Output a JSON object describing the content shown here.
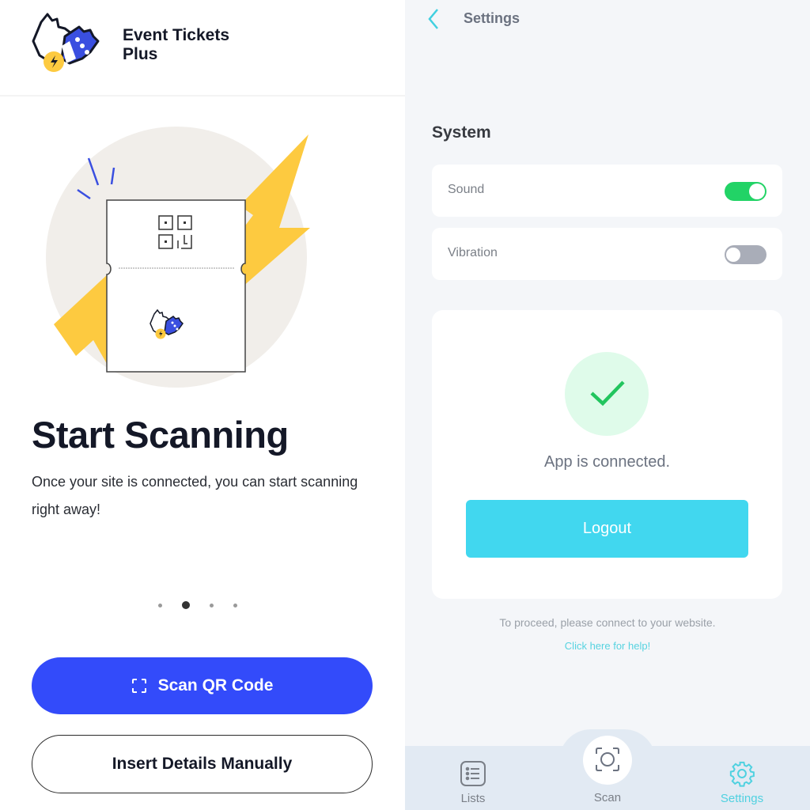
{
  "left": {
    "brand": {
      "line1": "Event Tickets",
      "line2": "Plus"
    },
    "onboarding": {
      "title": "Start Scanning",
      "description": "Once your site is connected, you can start scanning right away!",
      "pagination": {
        "total": 4,
        "active_index": 1
      }
    },
    "buttons": {
      "scan_qr": "Scan QR Code",
      "insert_manually": "Insert Details Manually"
    },
    "colors": {
      "primary": "#334bfa",
      "accent_yellow": "#fdca40",
      "ink": "#141827"
    }
  },
  "right": {
    "header": {
      "title": "Settings",
      "back_icon": "chevron-left-icon"
    },
    "system": {
      "heading": "System",
      "settings": [
        {
          "label": "Sound",
          "enabled": true
        },
        {
          "label": "Vibration",
          "enabled": false
        }
      ]
    },
    "connection": {
      "status": "App is connected.",
      "status_icon": "check-icon",
      "logout_label": "Logout"
    },
    "hint": "To proceed, please connect to your website.",
    "help_link": "Click here for help!",
    "tabbar": {
      "tabs": [
        {
          "label": "Lists",
          "icon": "list-icon",
          "active": false
        },
        {
          "label": "Scan",
          "icon": "scan-icon",
          "active": false
        },
        {
          "label": "Settings",
          "icon": "gear-icon",
          "active": true
        }
      ]
    },
    "colors": {
      "toggle_on": "#22d366",
      "toggle_off": "#a9adb8",
      "accent": "#41d7ef",
      "success_bg": "#dffbea"
    }
  }
}
